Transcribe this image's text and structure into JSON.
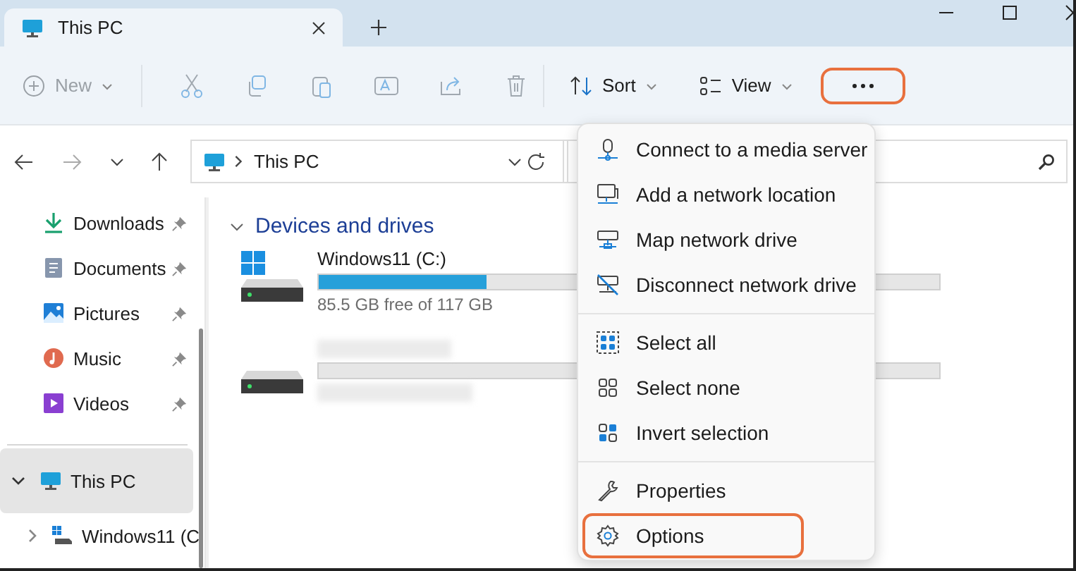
{
  "tabs": [
    {
      "label": "This PC",
      "selected": true
    }
  ],
  "toolbar": {
    "new": {
      "label": "New",
      "disabled": true
    },
    "sort": {
      "label": "Sort"
    },
    "view": {
      "label": "View"
    },
    "more": {
      "highlighted": true
    }
  },
  "address": {
    "path": [
      "This PC"
    ]
  },
  "sidebar": {
    "quick_access": [
      {
        "label": "Downloads",
        "pinned": true
      },
      {
        "label": "Documents",
        "pinned": true
      },
      {
        "label": "Pictures",
        "pinned": true
      },
      {
        "label": "Music",
        "pinned": true
      },
      {
        "label": "Videos",
        "pinned": true
      }
    ],
    "this_pc": {
      "label": "This PC",
      "selected": true,
      "expanded": true,
      "children": [
        {
          "label": "Windows11 (C",
          "expanded": false
        }
      ]
    }
  },
  "content": {
    "section": {
      "title": "Devices and drives",
      "expanded": true
    },
    "drives": [
      {
        "kind": "system",
        "name": "Windows11 (C:)",
        "free": "85.5 GB free of 117 GB",
        "level": 0.27
      },
      {
        "kind": "blurred"
      }
    ]
  },
  "menu": {
    "groups": [
      [
        {
          "label": "Connect to a media server",
          "highlighted": false
        },
        {
          "label": "Add a network location",
          "highlighted": false
        },
        {
          "label": "Map network drive",
          "highlighted": false
        },
        {
          "label": "Disconnect network drive",
          "highlighted": false
        }
      ],
      [
        {
          "label": "Select all",
          "highlighted": false
        },
        {
          "label": "Select none",
          "highlighted": false
        },
        {
          "label": "Invert selection",
          "highlighted": false
        }
      ],
      [
        {
          "label": "Properties",
          "highlighted": false
        },
        {
          "label": "Options",
          "highlighted": true
        }
      ]
    ]
  }
}
